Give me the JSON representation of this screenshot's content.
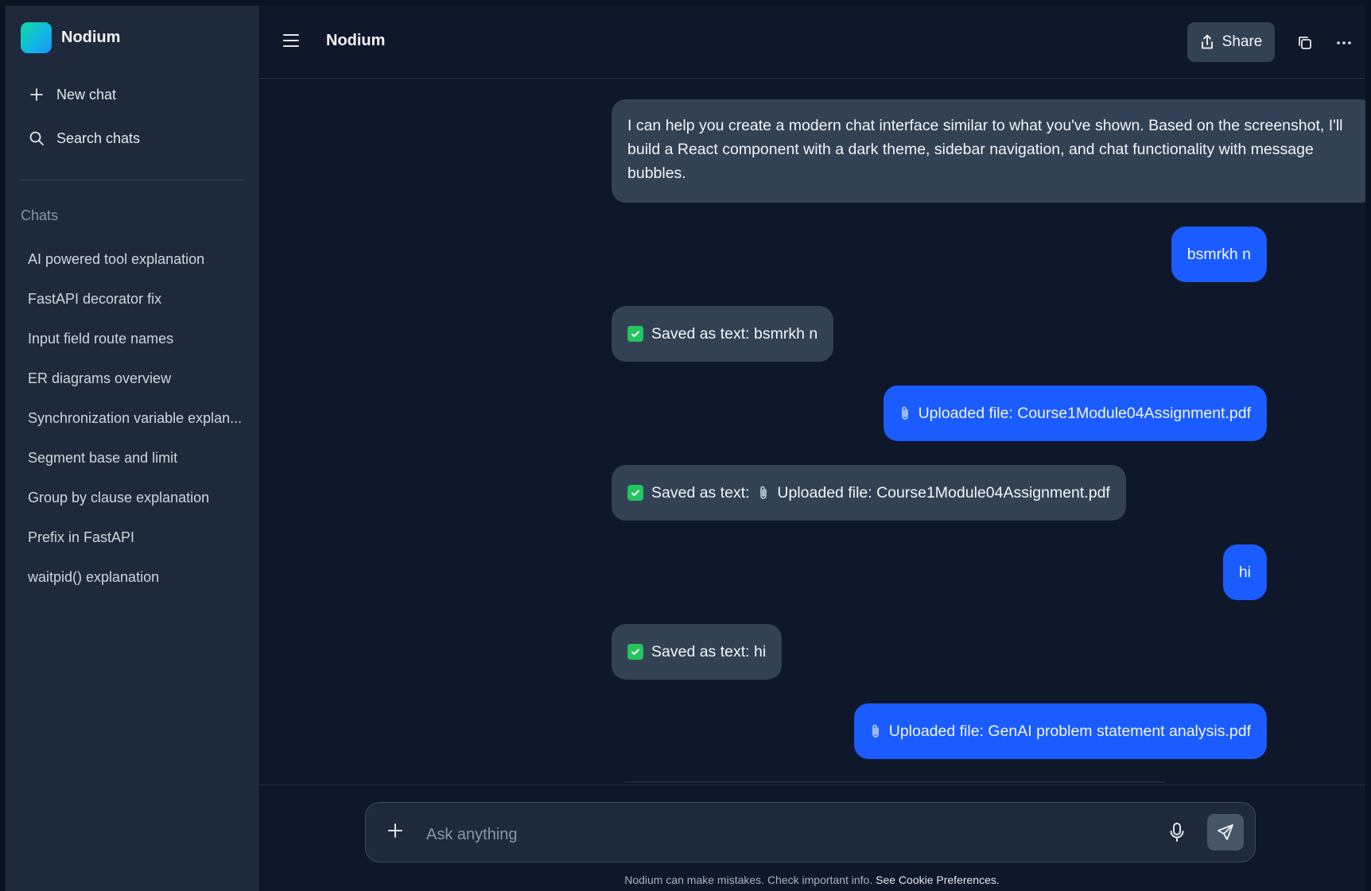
{
  "app": {
    "name": "Nodium"
  },
  "sidebar": {
    "new_chat": "New chat",
    "search_chats": "Search chats",
    "section_label": "Chats",
    "items": [
      {
        "label": "AI powered tool explanation"
      },
      {
        "label": "FastAPI decorator fix"
      },
      {
        "label": "Input field route names"
      },
      {
        "label": "ER diagrams overview"
      },
      {
        "label": "Synchronization variable explan..."
      },
      {
        "label": "Segment base and limit"
      },
      {
        "label": "Group by clause explanation"
      },
      {
        "label": "Prefix in FastAPI"
      },
      {
        "label": "waitpid() explanation"
      }
    ]
  },
  "header": {
    "title": "Nodium",
    "share_label": "Share"
  },
  "messages": [
    {
      "role": "assistant",
      "text": "I can help you create a modern chat interface similar to what you've shown. Based on the screenshot, I'll build a React component with a dark theme, sidebar navigation, and chat functionality with message bubbles."
    },
    {
      "role": "user",
      "text": "bsmrkh n"
    },
    {
      "role": "assistant",
      "prefix": "Saved as text:",
      "text": "bsmrkh n"
    },
    {
      "role": "user",
      "text": "Uploaded file: Course1Module04Assignment.pdf"
    },
    {
      "role": "assistant",
      "prefix": "Saved as text:",
      "text": "Uploaded file: Course1Module04Assignment.pdf"
    },
    {
      "role": "user",
      "text": "hi"
    },
    {
      "role": "assistant",
      "prefix": "Saved as text:",
      "text": "hi"
    },
    {
      "role": "user",
      "text": "Uploaded file: GenAI problem statement analysis.pdf"
    }
  ],
  "composer": {
    "placeholder": "Ask anything"
  },
  "footer": {
    "disclaimer": "Nodium can make mistakes. Check important info.",
    "link": "See Cookie Preferences."
  },
  "colors": {
    "accent": "#1a5cff",
    "check": "#22c55e",
    "bot_bubble": "#334155",
    "sidebar": "#1e293b"
  }
}
